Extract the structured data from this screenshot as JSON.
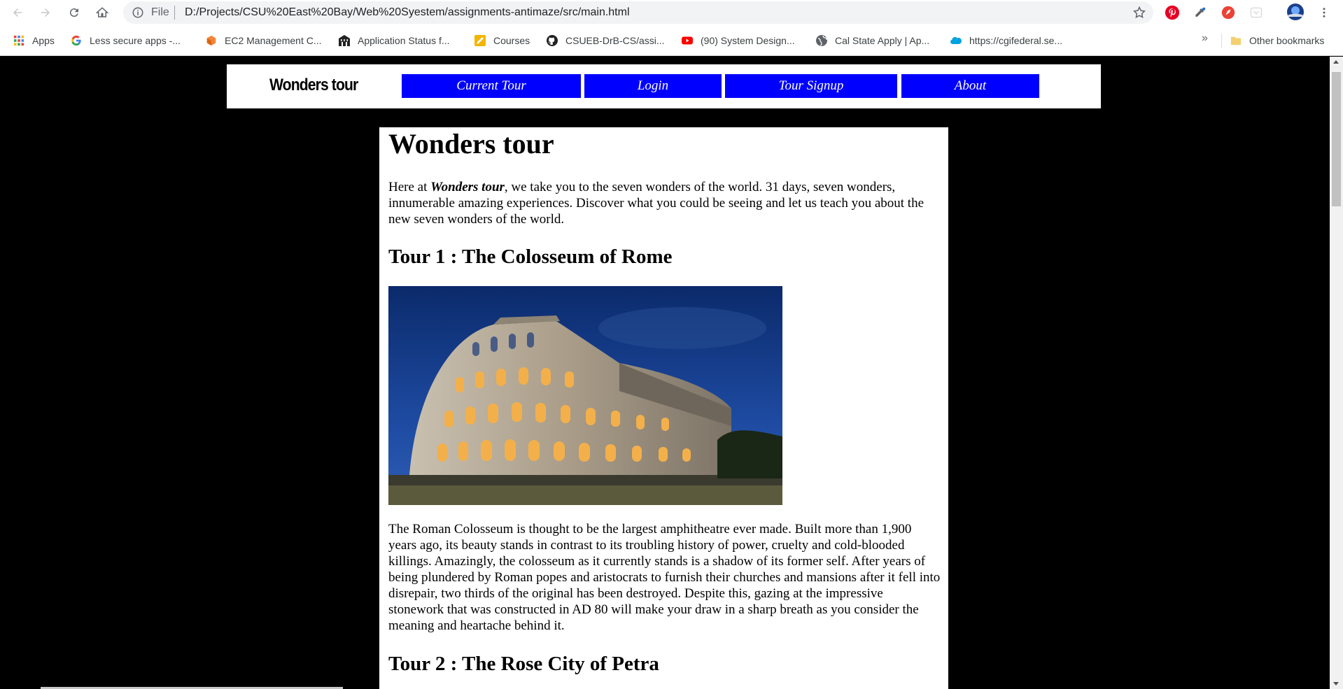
{
  "browser": {
    "omnibox": {
      "scheme_label": "File",
      "url": "D:/Projects/CSU%20East%20Bay/Web%20Syestem/assignments-antimaze/src/main.html"
    },
    "bookmarks": [
      {
        "label": "Apps",
        "icon": "apps-grid-icon"
      },
      {
        "label": "Less secure apps -...",
        "icon": "google-icon"
      },
      {
        "label": "EC2 Management C...",
        "icon": "aws-cube-icon"
      },
      {
        "label": "Application Status f...",
        "icon": "building-icon"
      },
      {
        "label": "Courses",
        "icon": "pencil-icon"
      },
      {
        "label": "CSUEB-DrB-CS/assi...",
        "icon": "github-icon"
      },
      {
        "label": "(90) System Design...",
        "icon": "youtube-icon"
      },
      {
        "label": "Cal State Apply | Ap...",
        "icon": "globe-icon"
      },
      {
        "label": "https://cgifederal.se...",
        "icon": "salesforce-cloud-icon"
      }
    ],
    "more_bookmarks": "»",
    "other_bookmarks": "Other bookmarks"
  },
  "site": {
    "logo": "Wonders tour",
    "nav": [
      {
        "label": "Current Tour"
      },
      {
        "label": "Login"
      },
      {
        "label": "Tour Signup"
      },
      {
        "label": "About"
      }
    ],
    "nav_color": "#0000ff",
    "page": {
      "title": "Wonders tour",
      "intro_prefix": "Here at ",
      "intro_em": "Wonders tour",
      "intro_suffix": ", we take you to the seven wonders of the world. 31 days, seven wonders, innumerable amazing experiences. Discover what you could be seeing and let us teach you about the new seven wonders of the world.",
      "tour1_title": "Tour 1 : The Colosseum of Rome",
      "tour1_desc": "The Roman Colosseum is thought to be the largest amphitheatre ever made. Built more than 1,900 years ago, its beauty stands in contrast to its troubling history of power, cruelty and cold-blooded killings. Amazingly, the colosseum as it currently stands is a shadow of its former self. After years of being plundered by Roman popes and aristocrats to furnish their churches and mansions after it fell into disrepair, two thirds of the original has been destroyed. Despite this, gazing at the impressive stonework that was constructed in AD 80 will make your draw in a sharp breath as you consider the meaning and heartache behind it.",
      "tour2_title": "Tour 2 : The Rose City of Petra"
    }
  }
}
